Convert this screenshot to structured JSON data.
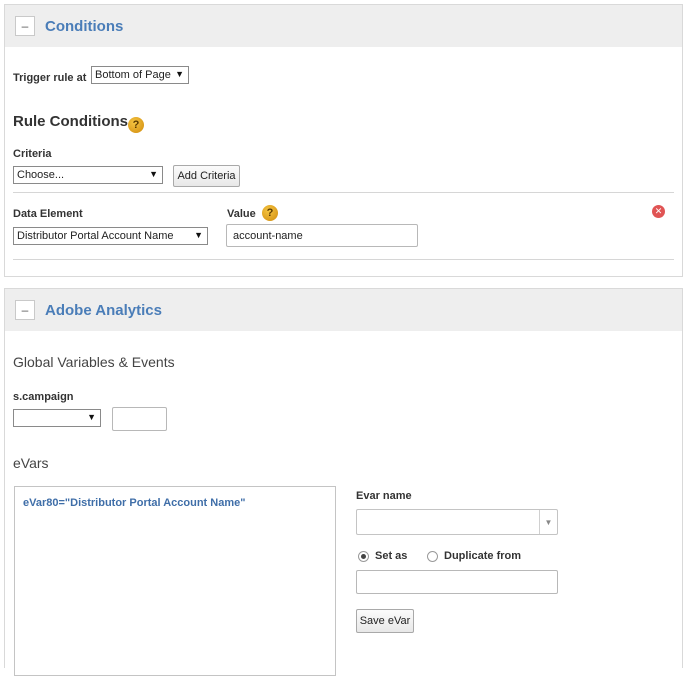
{
  "conditions": {
    "title": "Conditions",
    "collapse_symbol": "–",
    "trigger_label": "Trigger rule at",
    "trigger_value": "Bottom of Page",
    "rule_conditions_title": "Rule Conditions",
    "help_symbol": "?",
    "criteria_label": "Criteria",
    "criteria_value": "Choose...",
    "add_criteria_label": "Add Criteria",
    "data_element_label": "Data Element",
    "data_element_value": "Distributor Portal Account Name",
    "value_label": "Value",
    "value_input": "account-name",
    "remove_symbol": "✕"
  },
  "analytics": {
    "title": "Adobe Analytics",
    "collapse_symbol": "–",
    "global_heading": "Global Variables & Events",
    "campaign_label": "s.campaign",
    "campaign_select_value": "",
    "campaign_input_value": "",
    "evars_heading": "eVars",
    "evar_list": [
      "eVar80=\"Distributor Portal Account Name\""
    ],
    "evar_name_label": "Evar name",
    "evar_name_value": "",
    "set_as_label": "Set as",
    "duplicate_from_label": "Duplicate from",
    "set_as_input_value": "",
    "save_evar_label": "Save eVar"
  },
  "colors": {
    "accent": "#4a7db8",
    "header_bg": "#eeeeee",
    "remove": "#e05454",
    "help": "#e6a623"
  }
}
